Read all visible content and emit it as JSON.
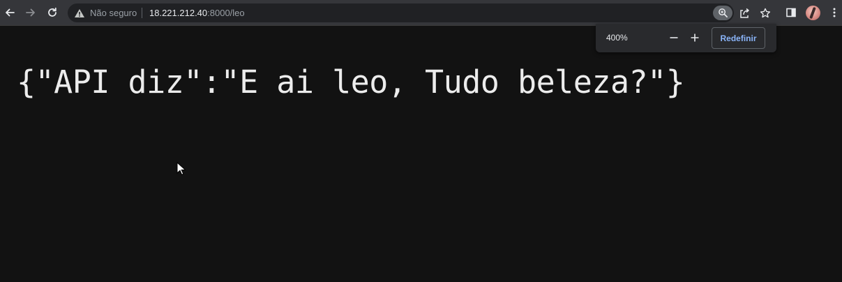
{
  "toolbar": {
    "back_icon": "arrow-left-icon",
    "forward_icon": "arrow-right-icon",
    "reload_icon": "reload-icon",
    "omnibox": {
      "security_icon": "warning-triangle-icon",
      "security_text": "Não seguro",
      "url_host": "18.221.212.40",
      "url_path": ":8000/leo",
      "zoom_icon": "zoom-magnifier-icon",
      "share_icon": "share-icon",
      "bookmark_icon": "star-icon"
    },
    "side_panel_icon": "side-panel-icon",
    "avatar_icon": "profile-avatar",
    "menu_icon": "kebab-menu-icon"
  },
  "zoom_bubble": {
    "level": "400%",
    "zoom_out_icon": "minus-icon",
    "zoom_in_icon": "plus-icon",
    "reset_label": "Redefinir",
    "reset_color": "#8ab4f8"
  },
  "page": {
    "content": "{\"API diz\":\"E ai leo, Tudo beleza?\"}",
    "background": "#121212"
  }
}
